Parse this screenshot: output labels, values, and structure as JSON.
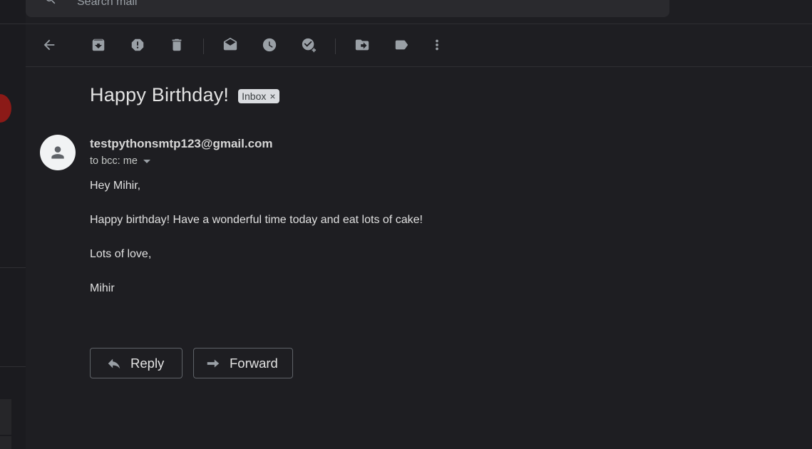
{
  "search": {
    "placeholder": "Search mail"
  },
  "toolbar": {
    "buttons": [
      {
        "name": "back",
        "icon": "arrow-left-icon"
      },
      {
        "name": "archive",
        "icon": "archive-icon"
      },
      {
        "name": "report-spam",
        "icon": "spam-icon"
      },
      {
        "name": "delete",
        "icon": "trash-icon"
      },
      {
        "name": "mark-unread",
        "icon": "mail-open-icon"
      },
      {
        "name": "snooze",
        "icon": "clock-icon"
      },
      {
        "name": "add-to-tasks",
        "icon": "add-task-icon"
      },
      {
        "name": "move-to",
        "icon": "move-folder-icon"
      },
      {
        "name": "labels",
        "icon": "label-icon"
      },
      {
        "name": "more",
        "icon": "more-vertical-icon"
      }
    ]
  },
  "message": {
    "subject": "Happy Birthday!",
    "label": "Inbox",
    "label_close": "×",
    "sender": "testpythonsmtp123@gmail.com",
    "recipient": "to bcc: me",
    "body": [
      "Hey Mihir,",
      "Happy birthday! Have a wonderful time today and eat lots of cake!",
      "Lots of love,",
      "Mihir"
    ]
  },
  "actions": {
    "reply_label": "Reply",
    "forward_label": "Forward"
  },
  "colors": {
    "background": "#1e1e22",
    "text": "#e3e3e3",
    "icon": "#9aa0a6",
    "chip_bg": "#dadce0",
    "rail_avatar": "#8b1a17"
  }
}
